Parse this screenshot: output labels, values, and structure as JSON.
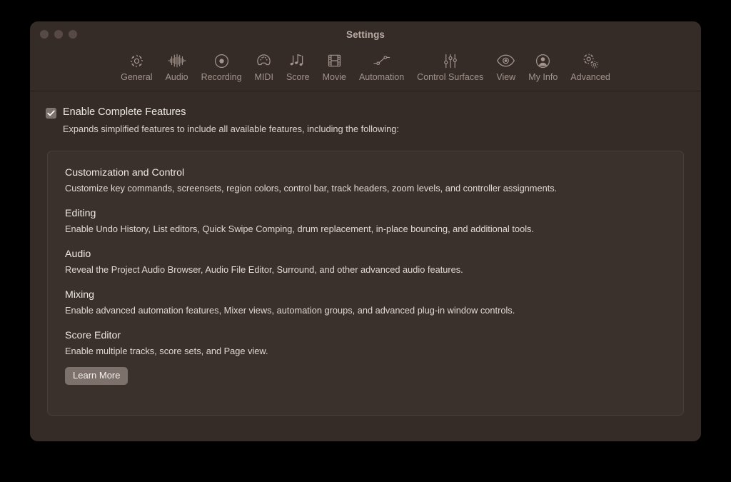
{
  "window": {
    "title": "Settings",
    "traffic_lights": [
      "close",
      "minimize",
      "zoom"
    ]
  },
  "toolbar": {
    "items": [
      {
        "label": "General",
        "icon": "gear-icon"
      },
      {
        "label": "Audio",
        "icon": "waveform-icon"
      },
      {
        "label": "Recording",
        "icon": "record-circle-icon"
      },
      {
        "label": "MIDI",
        "icon": "midi-connector-icon"
      },
      {
        "label": "Score",
        "icon": "music-notes-icon"
      },
      {
        "label": "Movie",
        "icon": "film-strip-icon"
      },
      {
        "label": "Automation",
        "icon": "automation-node-icon"
      },
      {
        "label": "Control Surfaces",
        "icon": "sliders-icon"
      },
      {
        "label": "View",
        "icon": "eye-icon"
      },
      {
        "label": "My Info",
        "icon": "person-circle-icon"
      },
      {
        "label": "Advanced",
        "icon": "double-gear-icon"
      }
    ],
    "selected": "Advanced"
  },
  "main": {
    "enable_complete_features": {
      "label": "Enable Complete Features",
      "checked": true,
      "description": "Expands simplified features to include all available features, including the following:"
    },
    "features": [
      {
        "title": "Customization and Control",
        "description": "Customize key commands, screensets, region colors, control bar, track headers, zoom levels, and controller assignments."
      },
      {
        "title": "Editing",
        "description": "Enable Undo History, List editors, Quick Swipe Comping, drum replacement, in-place bouncing, and additional tools."
      },
      {
        "title": "Audio",
        "description": "Reveal the Project Audio Browser, Audio File Editor, Surround, and other advanced audio features."
      },
      {
        "title": "Mixing",
        "description": "Enable advanced automation features, Mixer views, automation groups, and advanced plug-in window controls."
      },
      {
        "title": "Score Editor",
        "description": "Enable multiple tracks, score sets, and Page view."
      }
    ],
    "learn_more_label": "Learn More"
  },
  "colors": {
    "window_background": "#352c28",
    "panel_background": "#3a302c",
    "panel_border": "#4a3e39",
    "text_primary": "#efe9e5",
    "text_secondary": "#a2938c",
    "control_fill": "#7d716b",
    "desktop_background": "#000000"
  }
}
